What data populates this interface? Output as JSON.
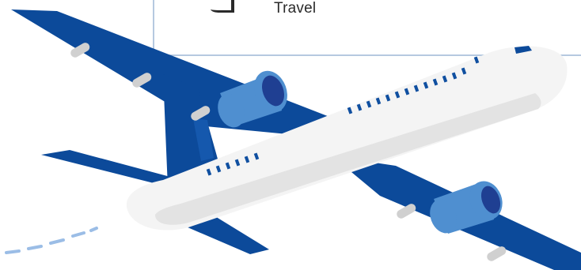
{
  "label": {
    "text": "Travel"
  },
  "icons": {
    "main": "airplane-icon",
    "badge": "tag-icon",
    "trail": "flight-path-dashes"
  },
  "colors": {
    "background": "#ffffff",
    "frame_line": "#9db7d6",
    "wing_blue": "#0c4a9a",
    "engine_light": "#4f8fd0",
    "engine_dark": "#1f3f92",
    "fuselage": "#f4f4f4",
    "fuselage_shadow": "#e3e3e3",
    "window": "#0f4fa0",
    "pylon": "#d0d0d0",
    "trail": "#9bbde6",
    "text": "#2a2a2a"
  }
}
